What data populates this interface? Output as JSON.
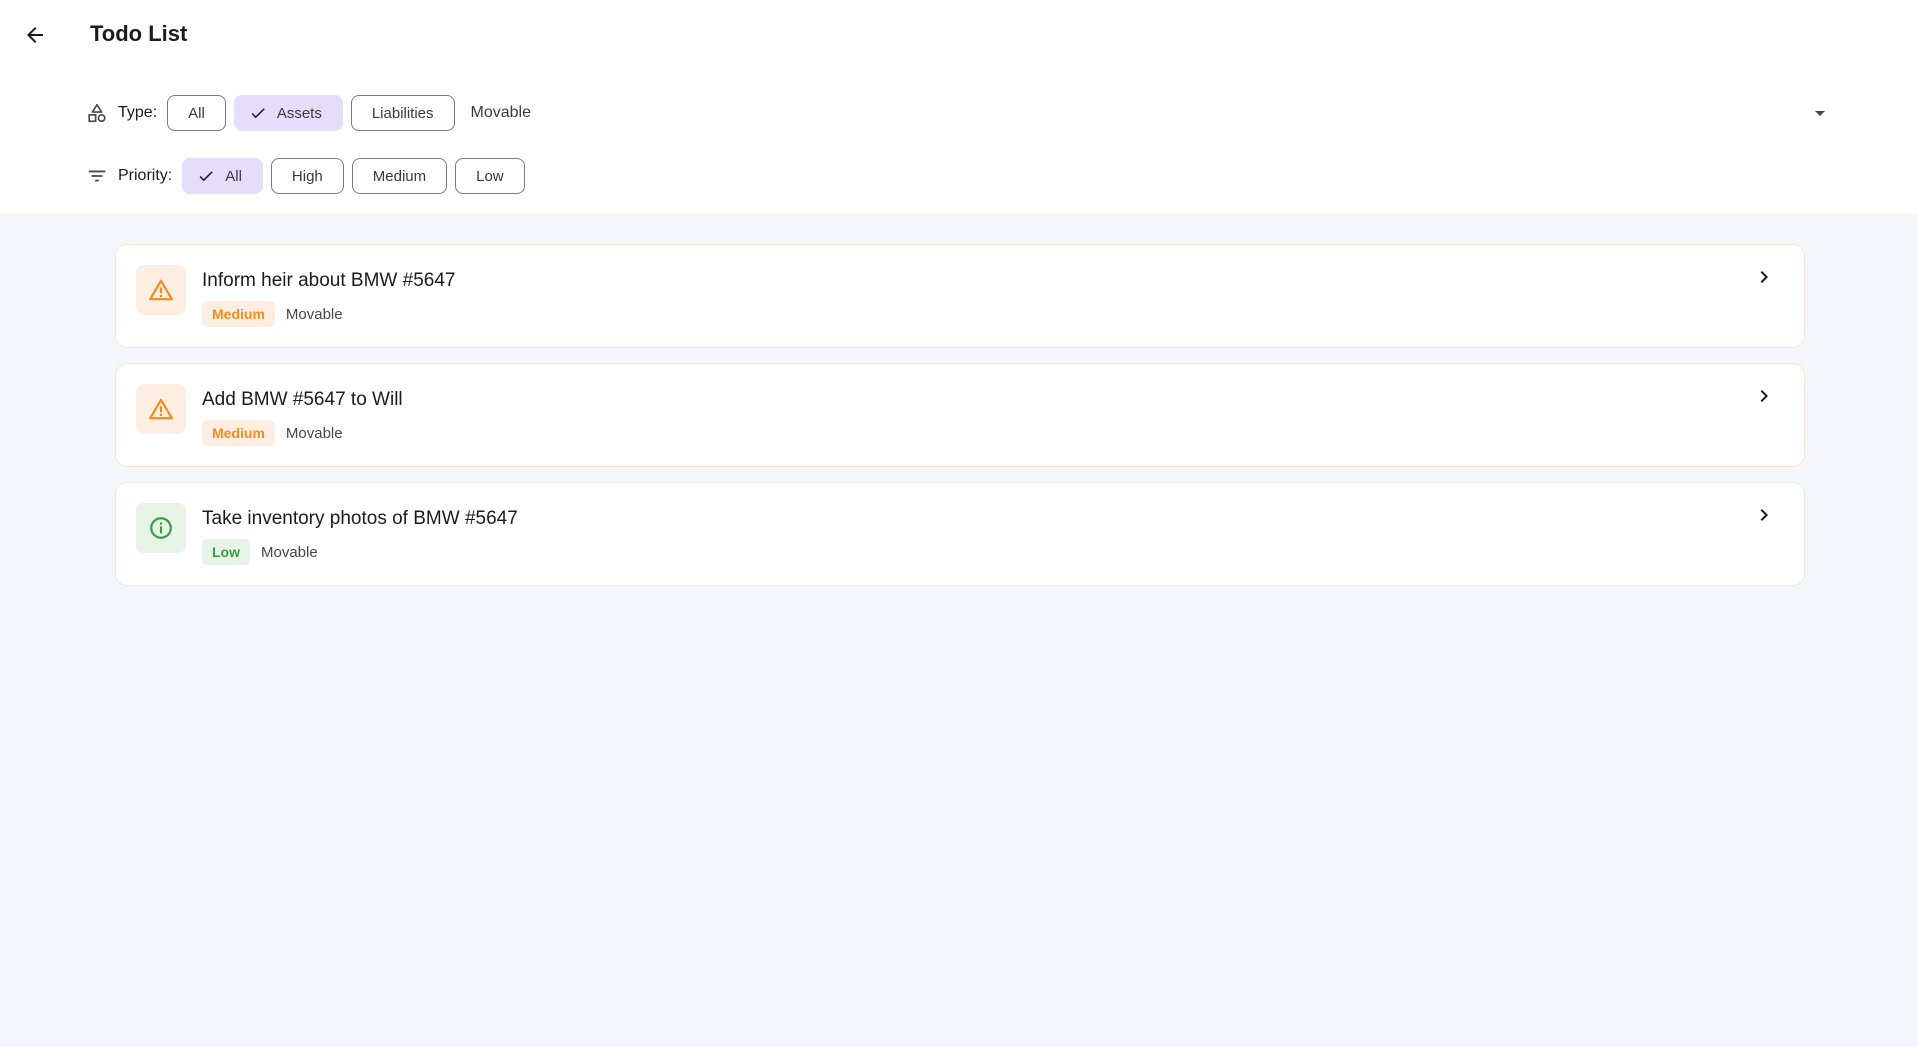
{
  "header": {
    "title": "Todo List"
  },
  "filters": {
    "type": {
      "label": "Type:",
      "chips": [
        {
          "label": "All",
          "selected": false
        },
        {
          "label": "Assets",
          "selected": true
        },
        {
          "label": "Liabilities",
          "selected": false
        }
      ],
      "subcategory": "Movable"
    },
    "priority": {
      "label": "Priority:",
      "chips": [
        {
          "label": "All",
          "selected": true
        },
        {
          "label": "High",
          "selected": false
        },
        {
          "label": "Medium",
          "selected": false
        },
        {
          "label": "Low",
          "selected": false
        }
      ]
    }
  },
  "todos": [
    {
      "title": "Inform heir about BMW #5647",
      "priority": "Medium",
      "category": "Movable",
      "icon": "warning-icon"
    },
    {
      "title": "Add BMW #5647 to Will",
      "priority": "Medium",
      "category": "Movable",
      "icon": "warning-icon"
    },
    {
      "title": "Take inventory photos of BMW #5647",
      "priority": "Low",
      "category": "Movable",
      "icon": "info-icon"
    }
  ],
  "colors": {
    "medium_accent": "#f08c1c",
    "low_accent": "#3f9a45",
    "selected_chip": "#e4defa",
    "page_bg": "#f4f6fc"
  }
}
